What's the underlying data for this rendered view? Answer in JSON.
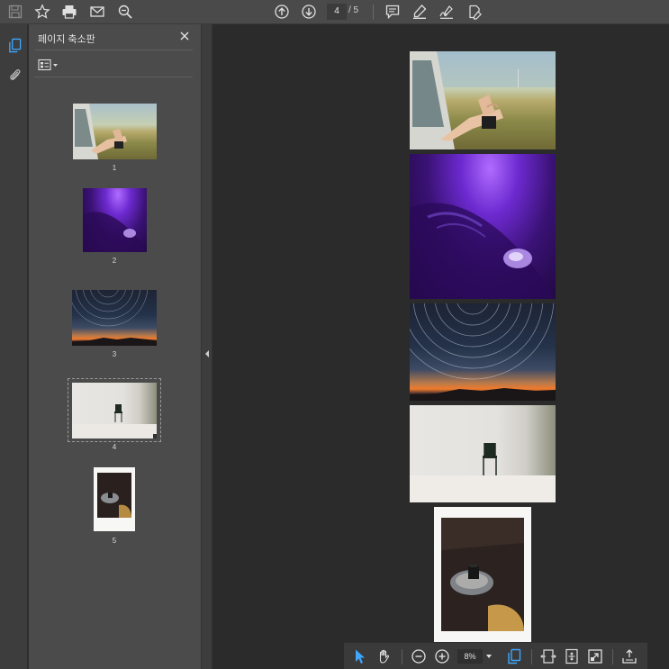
{
  "toolbar": {
    "current_page": "4",
    "page_total": "/ 5",
    "icons": [
      "save-icon",
      "star-icon",
      "print-icon",
      "mail-icon",
      "zoom-search-icon",
      "prev-page-icon",
      "next-page-icon",
      "comment-icon",
      "highlight-icon",
      "sign-icon",
      "fill-sign-icon"
    ]
  },
  "panel": {
    "title": "페이지 축소판",
    "thumbnails": [
      {
        "number": "1",
        "subject": "car-feet"
      },
      {
        "number": "2",
        "subject": "purple-portrait"
      },
      {
        "number": "3",
        "subject": "star-trails"
      },
      {
        "number": "4",
        "subject": "chair",
        "selected": true
      },
      {
        "number": "5",
        "subject": "polaroid"
      }
    ]
  },
  "bottom_bar": {
    "zoom": "8%"
  },
  "colors": {
    "accent": "#3fa7ff",
    "toolbar_bg": "#4a4a4a",
    "panel_bg": "#4b4b4b",
    "doc_bg": "#2b2b2b"
  }
}
